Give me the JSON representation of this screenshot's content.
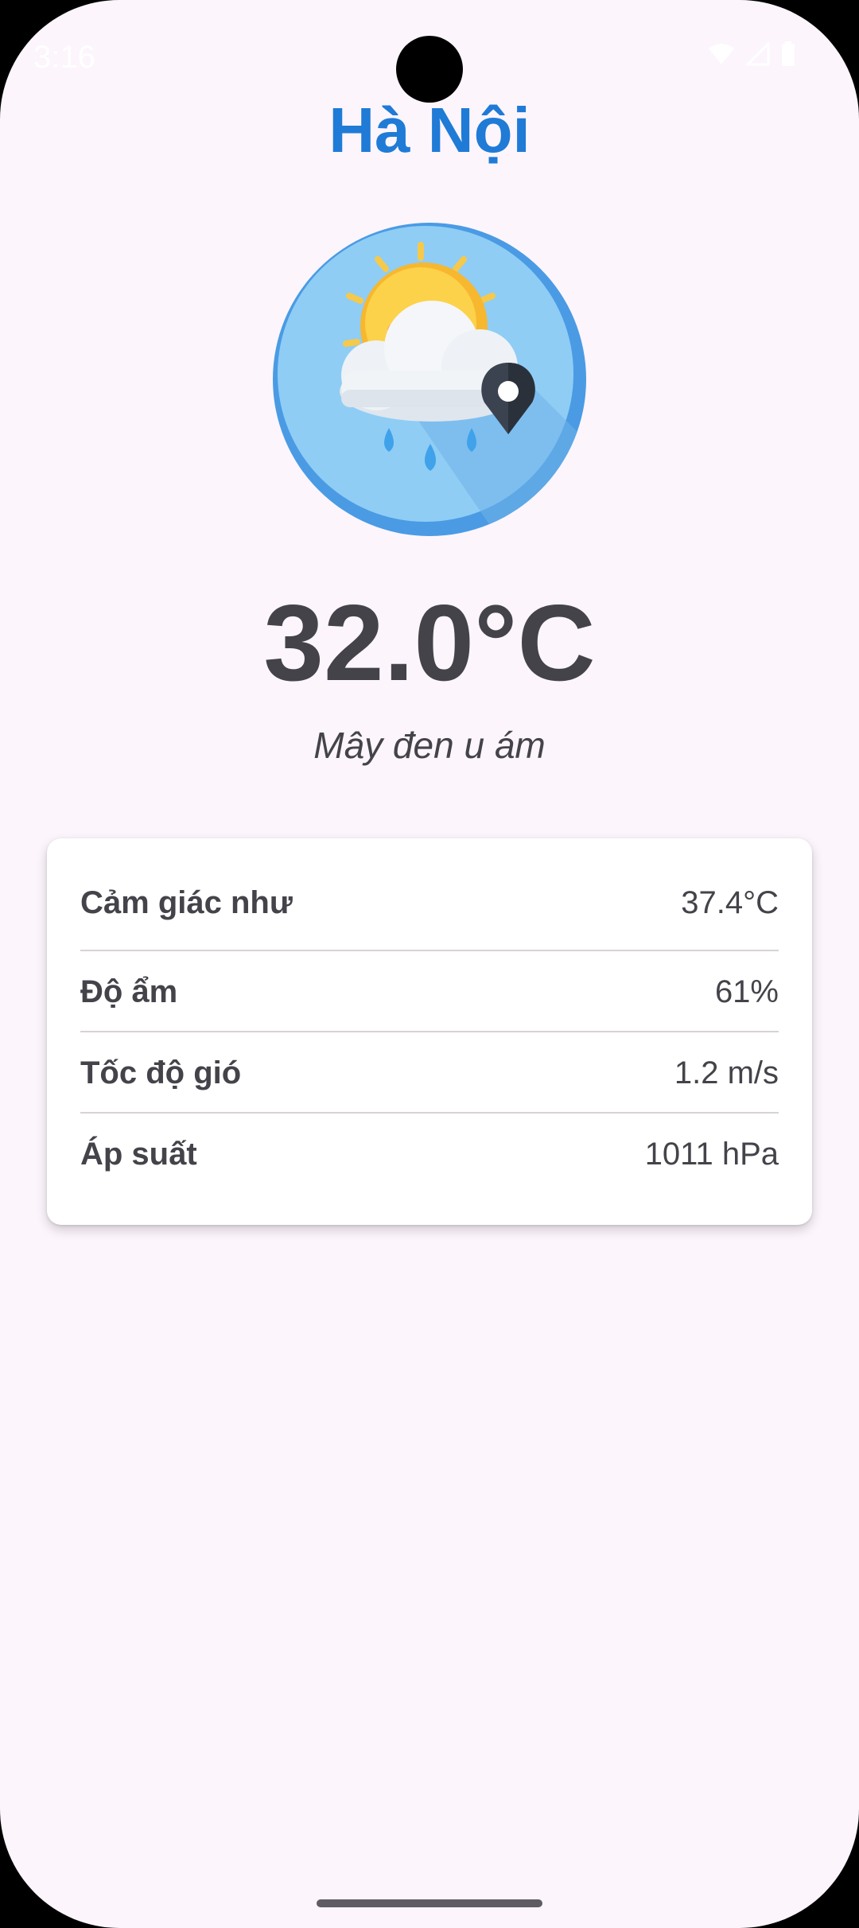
{
  "status_bar": {
    "time": "3:16",
    "icons": [
      "wifi-icon",
      "signal-icon",
      "battery-icon"
    ]
  },
  "header": {
    "city": "Hà Nội"
  },
  "weather": {
    "icon": "sun-cloud-rain-location-icon",
    "temperature": "32.0°C",
    "description": "Mây đen u ám"
  },
  "details": [
    {
      "label": "Cảm giác như",
      "value": "37.4°C"
    },
    {
      "label": "Độ ẩm",
      "value": "61%"
    },
    {
      "label": "Tốc độ gió",
      "value": "1.2 m/s"
    },
    {
      "label": "Áp suất",
      "value": "1011 hPa"
    }
  ],
  "colors": {
    "accent": "#1f7bd6",
    "text": "#45434a",
    "background": "#fcf5fc"
  }
}
